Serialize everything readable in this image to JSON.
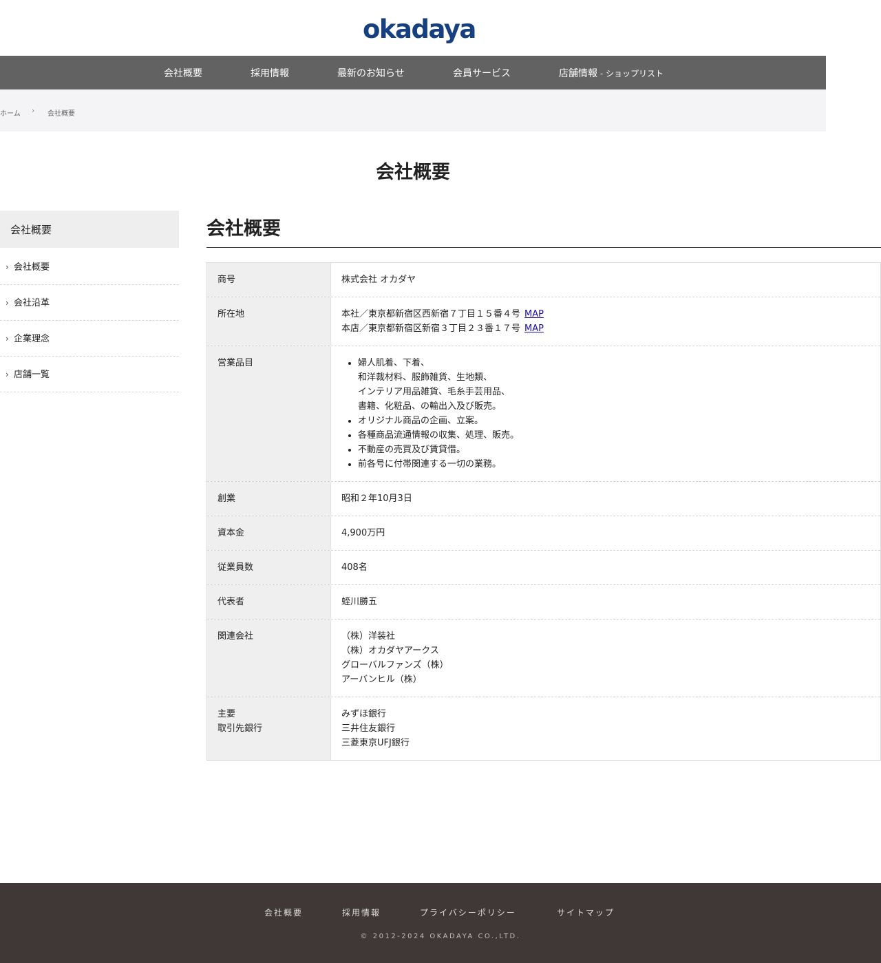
{
  "header": {
    "logo_text": "okadaya"
  },
  "nav": [
    {
      "label": "会社概要"
    },
    {
      "label": "採用情報"
    },
    {
      "label": "最新のお知らせ"
    },
    {
      "label": "会員サービス"
    },
    {
      "label": "店舗情報",
      "sub": " - ショップリスト"
    }
  ],
  "breadcrumb": {
    "home": "ホーム",
    "current": "会社概要",
    "separator": "›"
  },
  "page_title": "会社概要",
  "sidebar": {
    "heading": "会社概要",
    "items": [
      {
        "label": "会社概要"
      },
      {
        "label": "会社沿革"
      },
      {
        "label": "企業理念"
      },
      {
        "label": "店舗一覧"
      }
    ]
  },
  "main": {
    "title": "会社概要",
    "table": {
      "trade_name": {
        "label": "商号",
        "value": "株式会社 オカダヤ"
      },
      "address": {
        "label": "所在地",
        "head_office": "本社／東京都新宿区西新宿７丁目１５番４号",
        "main_store": "本店／東京都新宿区新宿３丁目２３番１７号",
        "map_label": "MAP"
      },
      "business": {
        "label": "営業品目",
        "items": [
          [
            "婦人肌着、下着、",
            "和洋裁材料、服飾雑貨、生地類、",
            "インテリア用品雑貨、毛糸手芸用品、",
            "書籍、化粧品、の輸出入及び販売。"
          ],
          [
            "オリジナル商品の企画、立案。"
          ],
          [
            "各種商品流通情報の収集、処理、販売。"
          ],
          [
            "不動産の売買及び賃貸借。"
          ],
          [
            "前各号に付帯関連する一切の業務。"
          ]
        ]
      },
      "founded": {
        "label": "創業",
        "value": "昭和２年10月3日"
      },
      "capital": {
        "label": "資本金",
        "value": "4,900万円"
      },
      "employees": {
        "label": "従業員数",
        "value": "408名"
      },
      "representative": {
        "label": "代表者",
        "value": "蛭川勝五"
      },
      "affiliates": {
        "label": "関連会社",
        "values": [
          "（株）洋装社",
          "（株）オカダヤアークス",
          "グローバルファンズ（株）",
          "アーバンヒル（株）"
        ]
      },
      "banks": {
        "label_line1": "主要",
        "label_line2": "取引先銀行",
        "values": [
          "みずほ銀行",
          "三井住友銀行",
          "三菱東京UFJ銀行"
        ]
      }
    }
  },
  "footer": {
    "links": [
      "会社概要",
      "採用情報",
      "プライバシーポリシー",
      "サイトマップ"
    ],
    "copyright": "© 2012-2024 OKADAYA CO.,LTD."
  }
}
